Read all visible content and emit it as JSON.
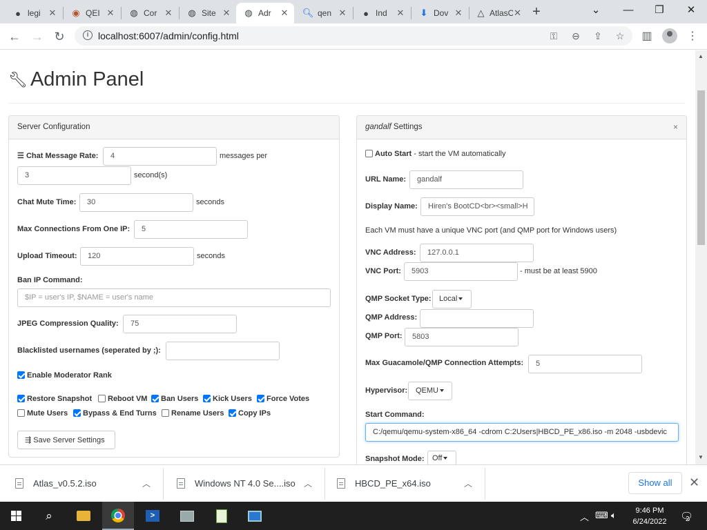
{
  "browser": {
    "tabs": [
      {
        "title": "legi",
        "icon": "github-icon"
      },
      {
        "title": "QEI",
        "icon": "qemu-icon"
      },
      {
        "title": "Cor",
        "icon": "globe-icon"
      },
      {
        "title": "Site",
        "icon": "globe-icon"
      },
      {
        "title": "Adr",
        "icon": "globe-icon"
      },
      {
        "title": "qen",
        "icon": "search-icon"
      },
      {
        "title": "Ind",
        "icon": "github-icon"
      },
      {
        "title": "Dov",
        "icon": "download-icon"
      },
      {
        "title": "AtlasOS",
        "icon": "atlas-icon"
      }
    ],
    "url": "localhost:6007/admin/config.html"
  },
  "page": {
    "title": "Admin Panel"
  },
  "server_config": {
    "heading": "Server Configuration",
    "chat_rate_label": "Chat Message Rate:",
    "chat_rate_value": "4",
    "chat_rate_suffix": "messages per",
    "chat_rate_seconds_value": "3",
    "chat_rate_seconds_suffix": "second(s)",
    "mute_label": "Chat Mute Time:",
    "mute_value": "30",
    "mute_suffix": "seconds",
    "max_conn_label": "Max Connections From One IP:",
    "max_conn_value": "5",
    "upload_label": "Upload Timeout:",
    "upload_value": "120",
    "upload_suffix": "seconds",
    "ban_label": "Ban IP Command:",
    "ban_placeholder": "$IP = user's IP, $NAME = user's name",
    "jpeg_label": "JPEG Compression Quality:",
    "jpeg_value": "75",
    "blacklist_label": "Blacklisted usernames (seperated by ;):",
    "blacklist_value": "",
    "mod_rank_label": "Enable Moderator Rank",
    "perms": [
      {
        "label": "Restore Snapshot",
        "checked": true
      },
      {
        "label": "Reboot VM",
        "checked": false
      },
      {
        "label": "Ban Users",
        "checked": true
      },
      {
        "label": "Kick Users",
        "checked": true
      },
      {
        "label": "Force Votes",
        "checked": true
      },
      {
        "label": "Mute Users",
        "checked": false
      },
      {
        "label": "Bypass & End Turns",
        "checked": true
      },
      {
        "label": "Rename Users",
        "checked": false
      },
      {
        "label": "Copy IPs",
        "checked": true
      }
    ],
    "save_label": "Save Server Settings"
  },
  "vm_settings": {
    "vm_name": "gandalf",
    "heading_suffix": " Settings",
    "close": "×",
    "autostart_label": "Auto Start",
    "autostart_desc": " - start the VM automatically",
    "url_name_label": "URL Name:",
    "url_name_value": "gandalf",
    "display_name_label": "Display Name:",
    "display_name_value": "Hiren's BootCD<br><small>H",
    "vnc_note": "Each VM must have a unique VNC port (and QMP port for Windows users)",
    "vnc_addr_label": "VNC Address:",
    "vnc_addr_value": "127.0.0.1",
    "vnc_port_label": "VNC Port:",
    "vnc_port_value": "5903",
    "vnc_port_suffix": "- must be at least 5900",
    "qmp_type_label": "QMP Socket Type:",
    "qmp_type_value": "Local",
    "qmp_addr_label": "QMP Address:",
    "qmp_addr_value": "",
    "qmp_port_label": "QMP Port:",
    "qmp_port_value": "5803",
    "guac_label": "Max Guacamole/QMP Connection Attempts:",
    "guac_value": "5",
    "hypervisor_label": "Hypervisor:",
    "hypervisor_value": "QEMU",
    "start_cmd_label": "Start Command:",
    "start_cmd_value": "C:/qemu/qemu-system-x86_64 -cdrom C:2Users|HBCD_PE_x86.iso -m 2048 -usbdevic",
    "snapshot_label": "Snapshot Mode:",
    "snapshot_value": "Off"
  },
  "downloads": {
    "items": [
      {
        "name": "Atlas_v0.5.2.iso"
      },
      {
        "name": "Windows NT 4.0 Se....iso"
      },
      {
        "name": "HBCD_PE_x64.iso"
      }
    ],
    "show_all": "Show all"
  },
  "taskbar": {
    "time": "9:46 PM",
    "date": "6/24/2022",
    "notification_count": "2"
  }
}
